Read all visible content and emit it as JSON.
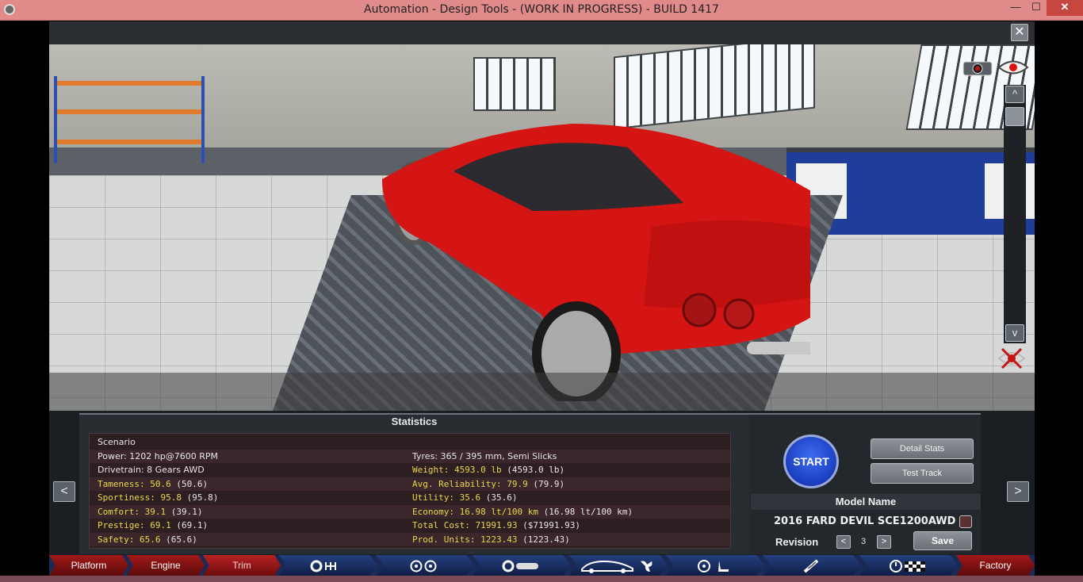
{
  "window": {
    "title": "Automation - Design Tools - (WORK IN PROGRESS) - BUILD 1417",
    "minimize": "—",
    "maximize": "☐",
    "close": "✕"
  },
  "viewer": {
    "close_label": "✕",
    "scroll_up": "^",
    "scroll_down": "v"
  },
  "statistics": {
    "title": "Statistics",
    "left": [
      {
        "text": "Scenario",
        "value": "",
        "paren": "",
        "color": "white"
      },
      {
        "text": "Power:",
        "value": "1202 hp@7600 RPM",
        "paren": "",
        "color": "white"
      },
      {
        "text": "Drivetrain:",
        "value": "8 Gears AWD",
        "paren": "",
        "color": "white"
      },
      {
        "text": "Tameness:",
        "value": "50.6",
        "paren": "(50.6)",
        "color": "yellow"
      },
      {
        "text": "Sportiness:",
        "value": "95.8",
        "paren": "(95.8)",
        "color": "yellow"
      },
      {
        "text": "Comfort:",
        "value": "39.1",
        "paren": "(39.1)",
        "color": "yellow"
      },
      {
        "text": "Prestige:",
        "value": "69.1",
        "paren": "(69.1)",
        "color": "yellow"
      },
      {
        "text": "Safety:",
        "value": "65.6",
        "paren": "(65.6)",
        "color": "yellow"
      }
    ],
    "right": [
      {
        "text": "",
        "value": "",
        "paren": "",
        "color": "white"
      },
      {
        "text": "Tyres:",
        "value": "365 / 395 mm, Semi Slicks",
        "paren": "",
        "color": "white"
      },
      {
        "text": "Weight:",
        "value": "4593.0 lb",
        "paren": "(4593.0 lb)",
        "color": "yellow"
      },
      {
        "text": "Avg. Reliability:",
        "value": "79.9",
        "paren": "(79.9)",
        "color": "yellow"
      },
      {
        "text": "Utility:",
        "value": "35.6",
        "paren": "(35.6)",
        "color": "yellow"
      },
      {
        "text": "Economy:",
        "value": "16.98 lt/100 km",
        "paren": "(16.98 lt/100 km)",
        "color": "yellow"
      },
      {
        "text": "Total Cost:",
        "value": "71991.93",
        "paren": "($71991.93)",
        "color": "yellow"
      },
      {
        "text": "Prod. Units:",
        "value": "1223.43",
        "paren": "(1223.43)",
        "color": "yellow"
      }
    ]
  },
  "nav": {
    "prev": "<",
    "next": ">"
  },
  "actions": {
    "start": "START",
    "detail_stats": "Detail Stats",
    "test_track": "Test Track",
    "model_name_header": "Model Name",
    "model_name": "2016 FARD DEVIL SCE1200AWD",
    "revision_label": "Revision",
    "revision_prev": "<",
    "revision_value": "3",
    "revision_next": ">",
    "save": "Save"
  },
  "tabs": [
    {
      "label": "Platform",
      "icon": "",
      "active": false,
      "color": "red"
    },
    {
      "label": "Engine",
      "icon": "",
      "active": false,
      "color": "red"
    },
    {
      "label": "Trim",
      "icon": "",
      "active": true,
      "color": "red"
    },
    {
      "label": "",
      "icon": "gearbox-icon",
      "active": false,
      "color": "blue"
    },
    {
      "label": "",
      "icon": "wheels-icon",
      "active": false,
      "color": "blue"
    },
    {
      "label": "",
      "icon": "suspension-icon",
      "active": false,
      "color": "blue"
    },
    {
      "label": "",
      "icon": "body-fan-icon",
      "active": false,
      "color": "blue"
    },
    {
      "label": "",
      "icon": "interior-icon",
      "active": false,
      "color": "blue"
    },
    {
      "label": "",
      "icon": "shock-icon",
      "active": false,
      "color": "blue"
    },
    {
      "label": "",
      "icon": "test-flag-icon",
      "active": false,
      "color": "blue"
    },
    {
      "label": "Factory",
      "icon": "",
      "active": false,
      "color": "red"
    }
  ]
}
